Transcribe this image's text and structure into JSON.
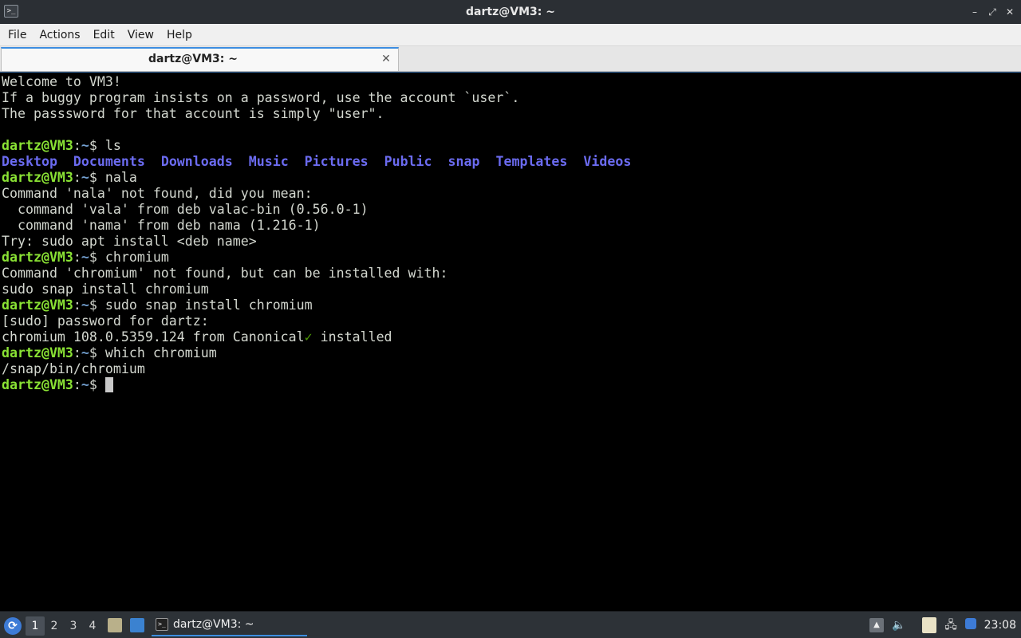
{
  "window": {
    "title": "dartz@VM3: ~",
    "app_icon_glyph": ">_",
    "minimize_glyph": "–",
    "maximize_glyph": "⤢",
    "close_glyph": "✕"
  },
  "menubar": {
    "items": [
      "File",
      "Actions",
      "Edit",
      "View",
      "Help"
    ]
  },
  "tabs": [
    {
      "label": "dartz@VM3: ~",
      "close_glyph": "✕",
      "active": true
    }
  ],
  "terminal": {
    "prompt": {
      "user_host": "dartz@VM3",
      "colon": ":",
      "path": "~",
      "dollar": "$ "
    },
    "lines": [
      {
        "kind": "text",
        "text": "Welcome to VM3!"
      },
      {
        "kind": "text",
        "text": "If a buggy program insists on a password, use the account `user`."
      },
      {
        "kind": "text",
        "text": "The passsword for that account is simply \"user\"."
      },
      {
        "kind": "text",
        "text": ""
      },
      {
        "kind": "prompt",
        "cmd": "ls"
      },
      {
        "kind": "dirs",
        "items": [
          "Desktop",
          "Documents",
          "Downloads",
          "Music",
          "Pictures",
          "Public",
          "snap",
          "Templates",
          "Videos"
        ]
      },
      {
        "kind": "prompt",
        "cmd": "nala"
      },
      {
        "kind": "text",
        "text": "Command 'nala' not found, did you mean:"
      },
      {
        "kind": "text",
        "text": "  command 'vala' from deb valac-bin (0.56.0-1)"
      },
      {
        "kind": "text",
        "text": "  command 'nama' from deb nama (1.216-1)"
      },
      {
        "kind": "text",
        "text": "Try: sudo apt install <deb name>"
      },
      {
        "kind": "prompt",
        "cmd": "chromium"
      },
      {
        "kind": "text",
        "text": "Command 'chromium' not found, but can be installed with:"
      },
      {
        "kind": "text",
        "text": "sudo snap install chromium"
      },
      {
        "kind": "prompt",
        "cmd": "sudo snap install chromium"
      },
      {
        "kind": "text",
        "text": "[sudo] password for dartz:"
      },
      {
        "kind": "installed",
        "before": "chromium 108.0.5359.124 from Canonical",
        "check": "✓",
        "after": " installed"
      },
      {
        "kind": "prompt",
        "cmd": "which chromium"
      },
      {
        "kind": "text",
        "text": "/snap/bin/chromium"
      },
      {
        "kind": "prompt",
        "cmd": "",
        "cursor": true
      }
    ]
  },
  "taskbar": {
    "start_glyph": "⟳",
    "workspaces": [
      "1",
      "2",
      "3",
      "4"
    ],
    "active_workspace": "1",
    "task_label": "dartz@VM3: ~",
    "task_icon_glyph": ">_",
    "tray_up_glyph": "▲",
    "volume_glyph": "🔈",
    "network_glyph": "🖧",
    "clock": "23:08"
  },
  "colors": {
    "prompt_user": "#8ae234",
    "prompt_path": "#729fcf",
    "directory": "#6b6bf0",
    "terminal_bg": "#000000",
    "terminal_fg": "#d3d7cf",
    "accent": "#3d8ee0"
  }
}
